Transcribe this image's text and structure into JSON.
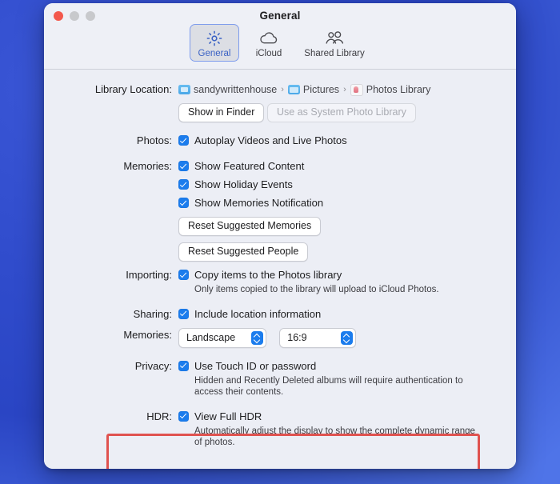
{
  "window": {
    "title": "General",
    "traffic_lights": [
      "close",
      "minimize",
      "maximize"
    ]
  },
  "toolbar": {
    "tabs": [
      {
        "label": "General",
        "icon": "gear-icon",
        "selected": true
      },
      {
        "label": "iCloud",
        "icon": "cloud-icon",
        "selected": false
      },
      {
        "label": "Shared Library",
        "icon": "people-icon",
        "selected": false
      }
    ]
  },
  "sections": {
    "library_location": {
      "label": "Library Location:",
      "breadcrumb": [
        {
          "text": "sandywrittenhouse",
          "icon": "home-folder-icon"
        },
        {
          "text": "Pictures",
          "icon": "folder-icon"
        },
        {
          "text": "Photos Library",
          "icon": "photos-library-icon"
        }
      ],
      "separator": "›",
      "buttons": [
        {
          "label": "Show in Finder",
          "enabled": true
        },
        {
          "label": "Use as System Photo Library",
          "enabled": false
        }
      ]
    },
    "photos": {
      "label": "Photos:",
      "checkbox": {
        "label": "Autoplay Videos and Live Photos",
        "checked": true
      }
    },
    "memories": {
      "label": "Memories:",
      "checkboxes": [
        {
          "label": "Show Featured Content",
          "checked": true
        },
        {
          "label": "Show Holiday Events",
          "checked": true
        },
        {
          "label": "Show Memories Notification",
          "checked": true
        }
      ],
      "buttons": [
        {
          "label": "Reset Suggested Memories"
        },
        {
          "label": "Reset Suggested People"
        }
      ]
    },
    "importing": {
      "label": "Importing:",
      "checkbox": {
        "label": "Copy items to the Photos library",
        "checked": true
      },
      "caption": "Only items copied to the library will upload to iCloud Photos."
    },
    "sharing": {
      "label": "Sharing:",
      "checkbox": {
        "label": "Include location information",
        "checked": true
      },
      "memories_label": "Memories:",
      "orientation_select": {
        "value": "Landscape"
      },
      "aspect_select": {
        "value": "16:9"
      }
    },
    "privacy": {
      "label": "Privacy:",
      "checkbox": {
        "label": "Use Touch ID or password",
        "checked": true
      },
      "caption": "Hidden and Recently Deleted albums will require authentication to access their contents."
    },
    "hdr": {
      "label": "HDR:",
      "checkbox": {
        "label": "View Full HDR",
        "checked": true
      },
      "caption": "Automatically adjust the display to show the complete dynamic range of photos."
    }
  },
  "annotation": {
    "color": "#e0524f",
    "target": "privacy"
  },
  "colors": {
    "accent": "#1b7ced",
    "selected_tab_border": "#7e9cec",
    "window_background": "#eceef5",
    "desktop": "#2f4bcb",
    "annotation_red": "#e0524f"
  }
}
